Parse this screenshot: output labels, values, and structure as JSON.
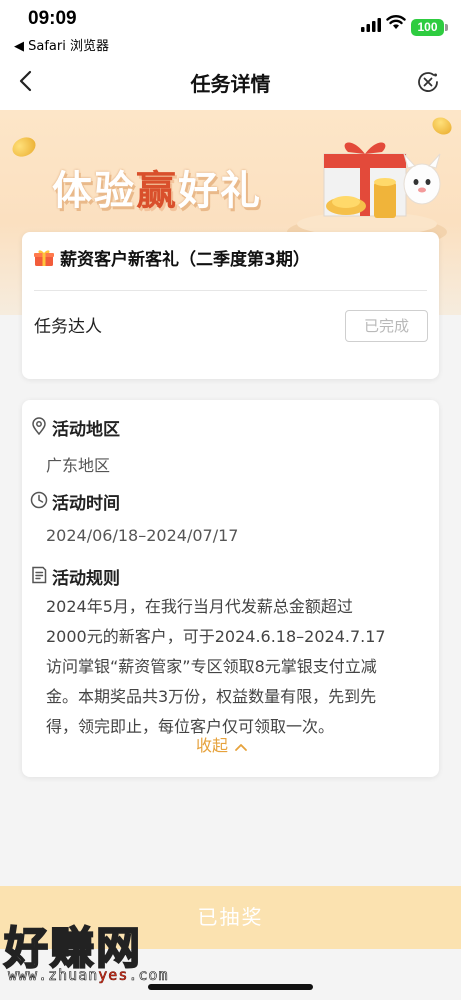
{
  "status": {
    "time": "09:09",
    "back_app": "◀ Safari 浏览器",
    "battery": "100"
  },
  "nav": {
    "title": "任务详情"
  },
  "banner": {
    "text_a": "体验",
    "text_b": "赢",
    "text_c": "好礼"
  },
  "task": {
    "title": "薪资客户新客礼（二季度第3期）",
    "label": "任务达人",
    "status_button": "已完成"
  },
  "info": {
    "region_title": "活动地区",
    "region_value": "广东地区",
    "time_title": "活动时间",
    "time_value": "2024/06/18–2024/07/17",
    "rules_title": "活动规则",
    "rules_lines": [
      "2024年5月，在我行当月代发薪总金额超过",
      "2000元的新客户，可于2024.6.18–2024.7.17",
      "访问掌银“薪资管家”专区领取8元掌银支付立减",
      "金。本期奖品共3万份，权益数量有限，先到先",
      "得，领完即止，每位客户仅可领取一次。"
    ],
    "collapse_label": "收起"
  },
  "bottom": {
    "button_label": "已抽奖"
  },
  "watermark": {
    "brand": "好赚网",
    "url_a": "www.zhuan",
    "url_b": "yes",
    "url_c": ".com"
  },
  "colors": {
    "accent": "#e6a23c",
    "banner_red": "#d9502c",
    "bottom_button": "#fbe2b0"
  }
}
